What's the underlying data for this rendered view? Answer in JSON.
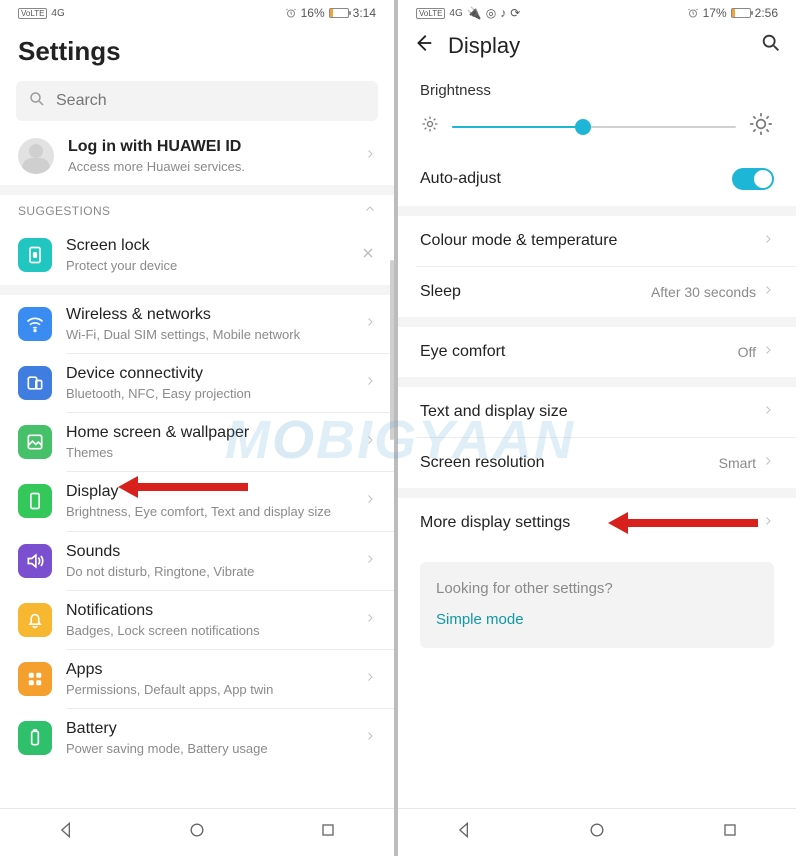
{
  "left": {
    "status": {
      "battery_pct": "16%",
      "time": "3:14",
      "signal": "4G"
    },
    "header": {
      "title": "Settings"
    },
    "search": {
      "placeholder": "Search"
    },
    "login": {
      "title": "Log in with HUAWEI ID",
      "sub": "Access more Huawei services."
    },
    "suggestions": {
      "header": "SUGGESTIONS",
      "item": {
        "label": "Screen lock",
        "sub": "Protect your device"
      }
    },
    "items": [
      {
        "label": "Wireless & networks",
        "sub": "Wi-Fi, Dual SIM settings, Mobile network"
      },
      {
        "label": "Device connectivity",
        "sub": "Bluetooth, NFC, Easy projection"
      },
      {
        "label": "Home screen & wallpaper",
        "sub": "Themes"
      },
      {
        "label": "Display",
        "sub": "Brightness, Eye comfort, Text and display size"
      },
      {
        "label": "Sounds",
        "sub": "Do not disturb, Ringtone, Vibrate"
      },
      {
        "label": "Notifications",
        "sub": "Badges, Lock screen notifications"
      },
      {
        "label": "Apps",
        "sub": "Permissions, Default apps, App twin"
      },
      {
        "label": "Battery",
        "sub": "Power saving mode, Battery usage"
      }
    ]
  },
  "right": {
    "status": {
      "battery_pct": "17%",
      "time": "2:56"
    },
    "header": {
      "title": "Display"
    },
    "brightness": {
      "label": "Brightness",
      "value_pct": 46
    },
    "auto_adjust": {
      "label": "Auto-adjust",
      "on": true
    },
    "rows": [
      {
        "label": "Colour mode & temperature",
        "value": ""
      },
      {
        "label": "Sleep",
        "value": "After 30 seconds"
      },
      {
        "label": "Eye comfort",
        "value": "Off"
      },
      {
        "label": "Text and display size",
        "value": ""
      },
      {
        "label": "Screen resolution",
        "value": "Smart"
      },
      {
        "label": "More display settings",
        "value": ""
      }
    ],
    "info": {
      "q": "Looking for other settings?",
      "link": "Simple mode"
    }
  },
  "watermark": "MOBIGYAAN"
}
